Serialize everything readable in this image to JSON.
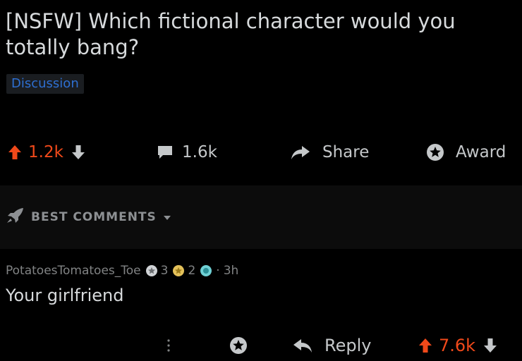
{
  "post": {
    "title": "[NSFW] Which fictional character would you totally bang?",
    "flair": "Discussion"
  },
  "post_actions": {
    "upvotes": "1.2k",
    "comments": "1.6k",
    "share": "Share",
    "award": "Award"
  },
  "comments_section": {
    "sort_label": "BEST COMMENTS"
  },
  "comment": {
    "author": "PotatoesTomatoes_Toe",
    "award_1_count": "3",
    "award_2_count": "2",
    "separator": "·",
    "time": "3h",
    "body": "Your girlfriend",
    "reply_label": "Reply",
    "upvotes": "7.6k"
  },
  "colors": {
    "background": "#000000",
    "text": "#d7dadc",
    "muted": "#818384",
    "upvote": "#f0491a",
    "flair_text": "#2e6fd1"
  }
}
